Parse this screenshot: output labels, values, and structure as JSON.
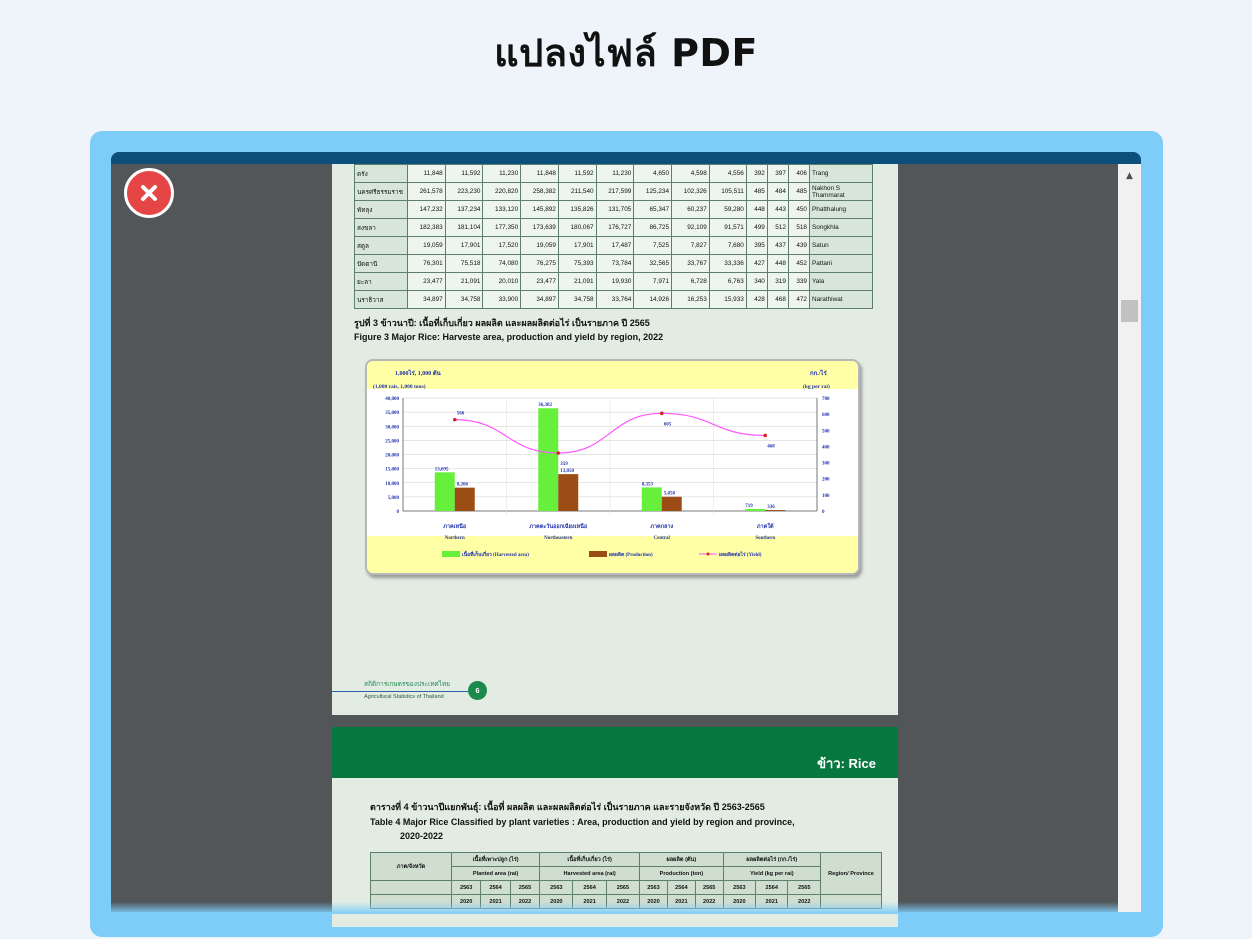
{
  "page": {
    "title": "แปลงไฟล์ PDF"
  },
  "colors": {
    "frame": "#7ecdf8",
    "close": "#e64545",
    "viewer_bg": "#525659",
    "green_band": "#06783f"
  },
  "icons": {
    "close": "close-x-icon",
    "scroll_up": "scroll-up-arrow-icon"
  },
  "pdf": {
    "page1": {
      "province_table": {
        "rows": [
          {
            "th": "ตรัง",
            "vals": [
              "11,848",
              "11,592",
              "11,230",
              "11,848",
              "11,592",
              "11,230",
              "4,650",
              "4,598",
              "4,556",
              "392",
              "397",
              "406"
            ],
            "en": "Trang"
          },
          {
            "th": "นครศรีธรรมราช",
            "vals": [
              "261,578",
              "223,230",
              "220,820",
              "258,382",
              "211,540",
              "217,599",
              "125,234",
              "102,326",
              "105,511",
              "485",
              "484",
              "485"
            ],
            "en": "Nakhon S Thammarat"
          },
          {
            "th": "พัทลุง",
            "vals": [
              "147,232",
              "137,234",
              "133,120",
              "145,892",
              "135,826",
              "131,705",
              "65,347",
              "60,237",
              "59,280",
              "448",
              "443",
              "450"
            ],
            "en": "Phatthalung"
          },
          {
            "th": "สงขลา",
            "vals": [
              "182,383",
              "181,104",
              "177,350",
              "173,639",
              "180,067",
              "176,727",
              "86,725",
              "92,109",
              "91,571",
              "499",
              "512",
              "518"
            ],
            "en": "Songkhla"
          },
          {
            "th": "สตูล",
            "vals": [
              "19,059",
              "17,901",
              "17,520",
              "19,059",
              "17,901",
              "17,487",
              "7,525",
              "7,827",
              "7,680",
              "395",
              "437",
              "439"
            ],
            "en": "Satun"
          },
          {
            "th": "ปัตตานี",
            "vals": [
              "76,301",
              "75,518",
              "74,080",
              "76,275",
              "75,393",
              "73,784",
              "32,565",
              "33,767",
              "33,336",
              "427",
              "448",
              "452"
            ],
            "en": "Pattani"
          },
          {
            "th": "ยะลา",
            "vals": [
              "23,477",
              "21,091",
              "20,010",
              "23,477",
              "21,091",
              "19,930",
              "7,971",
              "6,728",
              "6,763",
              "340",
              "319",
              "339"
            ],
            "en": "Yala"
          },
          {
            "th": "นราธิวาส",
            "vals": [
              "34,897",
              "34,758",
              "33,900",
              "34,897",
              "34,758",
              "33,764",
              "14,926",
              "16,253",
              "15,933",
              "428",
              "468",
              "472"
            ],
            "en": "Narathiwat"
          }
        ]
      },
      "figure_caption_th": "รูปที่    3  ข้าวนาปี: เนื้อที่เก็บเกี่ยว ผลผลิต และผลผลิตต่อไร่ เป็นรายภาค ปี 2565",
      "figure_caption_en": "Figure  3  Major Rice: Harveste area, production and yield by region, 2022",
      "footer_th": "สถิติการเกษตรของประเทศไทย",
      "footer_en": "Agricultural Statistics of Thailand",
      "page_number": "6"
    },
    "page2": {
      "band_title": "ข้าว: Rice",
      "table_title_th": "ตารางที่ 4  ข้าวนาปีแยกพันธุ์: เนื้อที่ ผลผลิต และผลผลิตต่อไร่ เป็นรายภาค และรายจังหวัด ปี 2563-2565",
      "table_title_en_1": "Table   4  Major Rice Classified by plant varieties : Area, production and yield by region and province,",
      "table_title_en_2": "2020-2022",
      "header": {
        "region_th": "ภาค/จังหวัด",
        "region_en": "Region/ Province",
        "groups": [
          {
            "th": "เนื้อที่เพาะปลูก (ไร่)",
            "en": "Planted area (rai)"
          },
          {
            "th": "เนื้อที่เก็บเกี่ยว (ไร่)",
            "en": "Harvested area (rai)"
          },
          {
            "th": "ผลผลิต (ตัน)",
            "en": "Production (ton)"
          },
          {
            "th": "ผลผลิตต่อไร่ (กก./ไร่)",
            "en": "Yield (kg per rai)"
          }
        ],
        "years_th": [
          "2563",
          "2564",
          "2565"
        ],
        "years_en": [
          "2020",
          "2021",
          "2022"
        ]
      }
    }
  },
  "chart_data": {
    "type": "bar",
    "left_unit_th": "1,000ไร่, 1,000 ตัน",
    "left_unit_en": "(1,000 rais,  1,000 tons)",
    "right_unit_th": "กก./ไร่",
    "right_unit_en": "(kg per rai)",
    "categories": [
      "ภาคเหนือ",
      "ภาคตะวันออกเฉียงเหนือ",
      "ภาคกลาง",
      "ภาคใต้"
    ],
    "categories_en": [
      "Northern",
      "Northeastern",
      "Central",
      "Southern"
    ],
    "series": [
      {
        "name": "เนื้อที่เก็บเกี่ยว  (Harvested area)",
        "type": "bar",
        "axis": "left",
        "color": "#66f03c",
        "values": [
          13695,
          36382,
          8353,
          719
        ]
      },
      {
        "name": "ผลผลิต  (Production)",
        "type": "bar",
        "axis": "left",
        "color": "#9c4d15",
        "values": [
          8266,
          13050,
          5058,
          336
        ]
      },
      {
        "name": "ผลผลิตต่อไร่ (Yield)",
        "type": "line",
        "axis": "right",
        "color": "#ff55ff",
        "values": [
          566,
          359,
          605,
          468
        ]
      }
    ],
    "value_labels": {
      "bar1": [
        "13,695",
        "36,382",
        "8,353",
        "719"
      ],
      "bar2": [
        "8,266",
        "13,050",
        "5,058",
        "336"
      ],
      "line": [
        "566",
        "359",
        "605",
        "468"
      ]
    },
    "ylim_left": [
      0,
      40000
    ],
    "yticks_left": [
      "0",
      "5,000",
      "10,000",
      "15,000",
      "20,000",
      "25,000",
      "30,000",
      "35,000",
      "40,000"
    ],
    "ylim_right": [
      0,
      700
    ],
    "yticks_right": [
      "0",
      "100",
      "200",
      "300",
      "400",
      "500",
      "600",
      "700"
    ],
    "grid": true,
    "legend": "bottom"
  }
}
